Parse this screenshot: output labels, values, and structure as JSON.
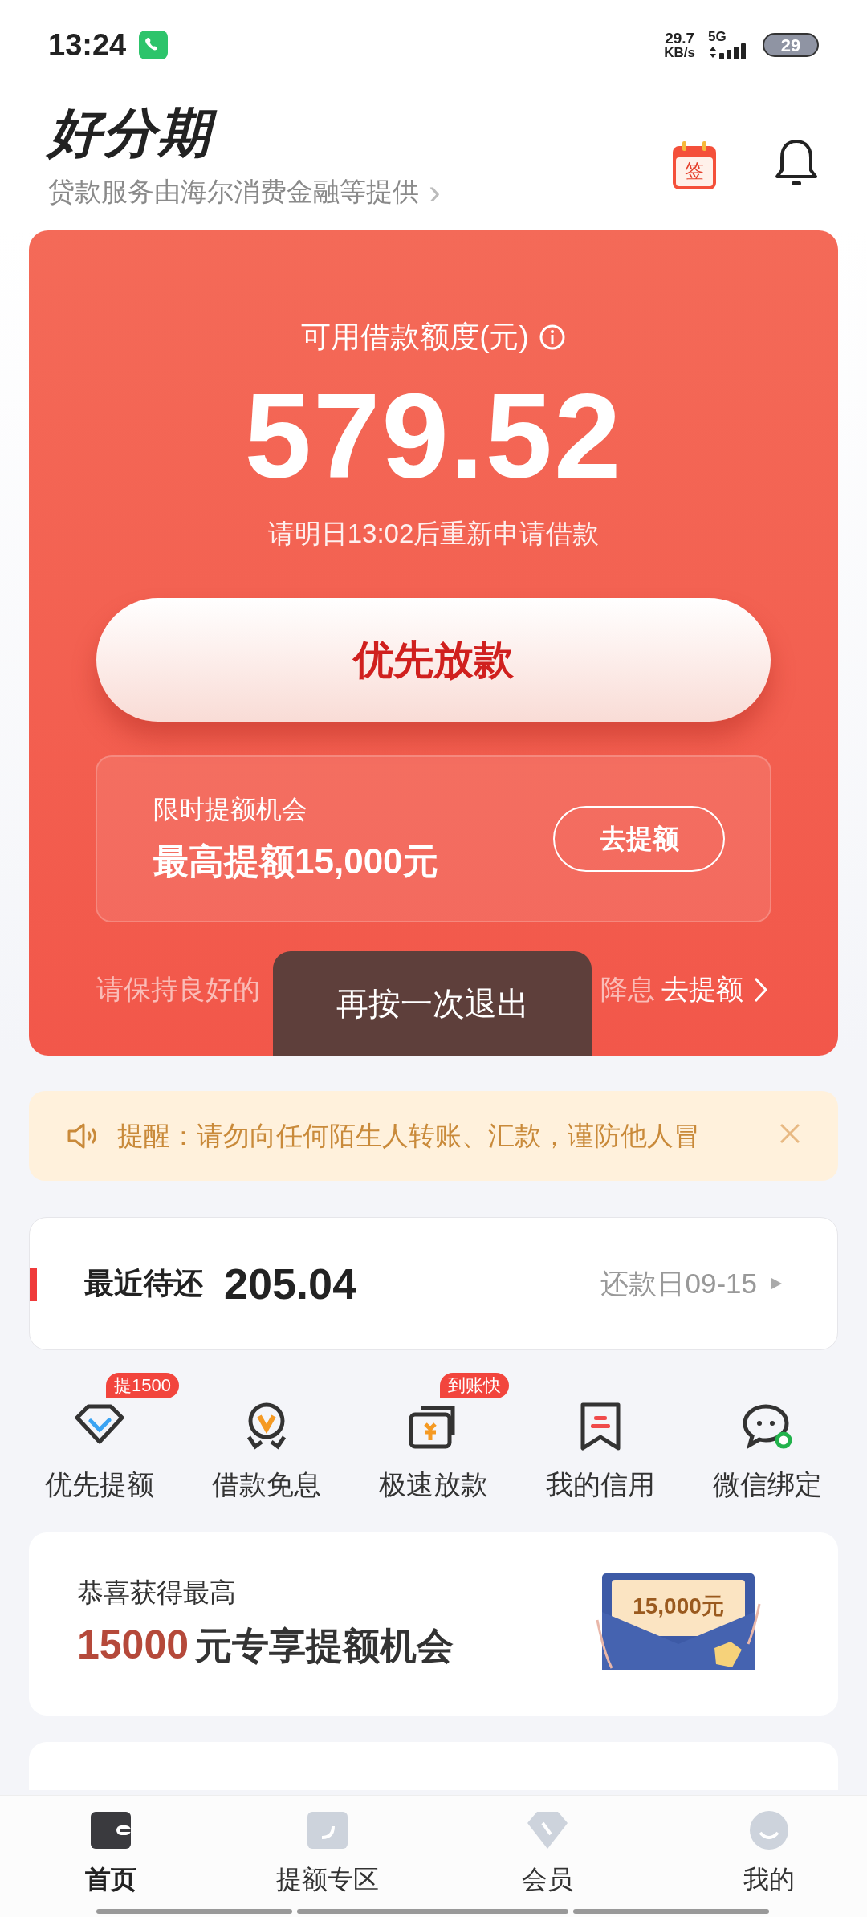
{
  "status_bar": {
    "time": "13:24",
    "speed": "29.7",
    "speed_unit": "KB/s",
    "network": "5G",
    "battery": "29"
  },
  "header": {
    "logo": "好分期",
    "checkin": "签",
    "subtitle": "贷款服务由海尔消费金融等提供",
    "arrow": "›"
  },
  "credit_card": {
    "label": "可用借款额度(元)",
    "amount": "579.52",
    "note": "请明日13:02后重新申请借款",
    "button": "优先放款",
    "boost": {
      "title": "限时提额机会",
      "headline": "最高提额15,000元",
      "button": "去提额"
    },
    "footer_start": "请保持良好的",
    "footer_end": "降息",
    "footer_link": "去提额"
  },
  "toast": "再按一次退出",
  "notice": {
    "text": "提醒：请勿向任何陌生人转账、汇款，谨防他人冒"
  },
  "repayment": {
    "label": "最近待还",
    "amount": "205.04",
    "due": "还款日09-15"
  },
  "shortcuts": [
    {
      "kind": "diamond",
      "label": "优先提额",
      "badge": "提1500"
    },
    {
      "kind": "medal",
      "label": "借款免息"
    },
    {
      "kind": "wallet",
      "label": "极速放款",
      "badge": "到账快"
    },
    {
      "kind": "bookmark",
      "label": "我的信用"
    },
    {
      "kind": "chat",
      "label": "微信绑定"
    }
  ],
  "promo": {
    "line1": "恭喜获得最高",
    "highlight": "15000",
    "line2": "元专享提额机会",
    "envelope_amount": "15,000元"
  },
  "nav": [
    {
      "kind": "wallet",
      "label": "首页",
      "selected": true
    },
    {
      "kind": "card",
      "label": "提额专区",
      "selected": false
    },
    {
      "kind": "diamond",
      "label": "会员",
      "selected": false
    },
    {
      "kind": "face",
      "label": "我的",
      "selected": false
    }
  ]
}
